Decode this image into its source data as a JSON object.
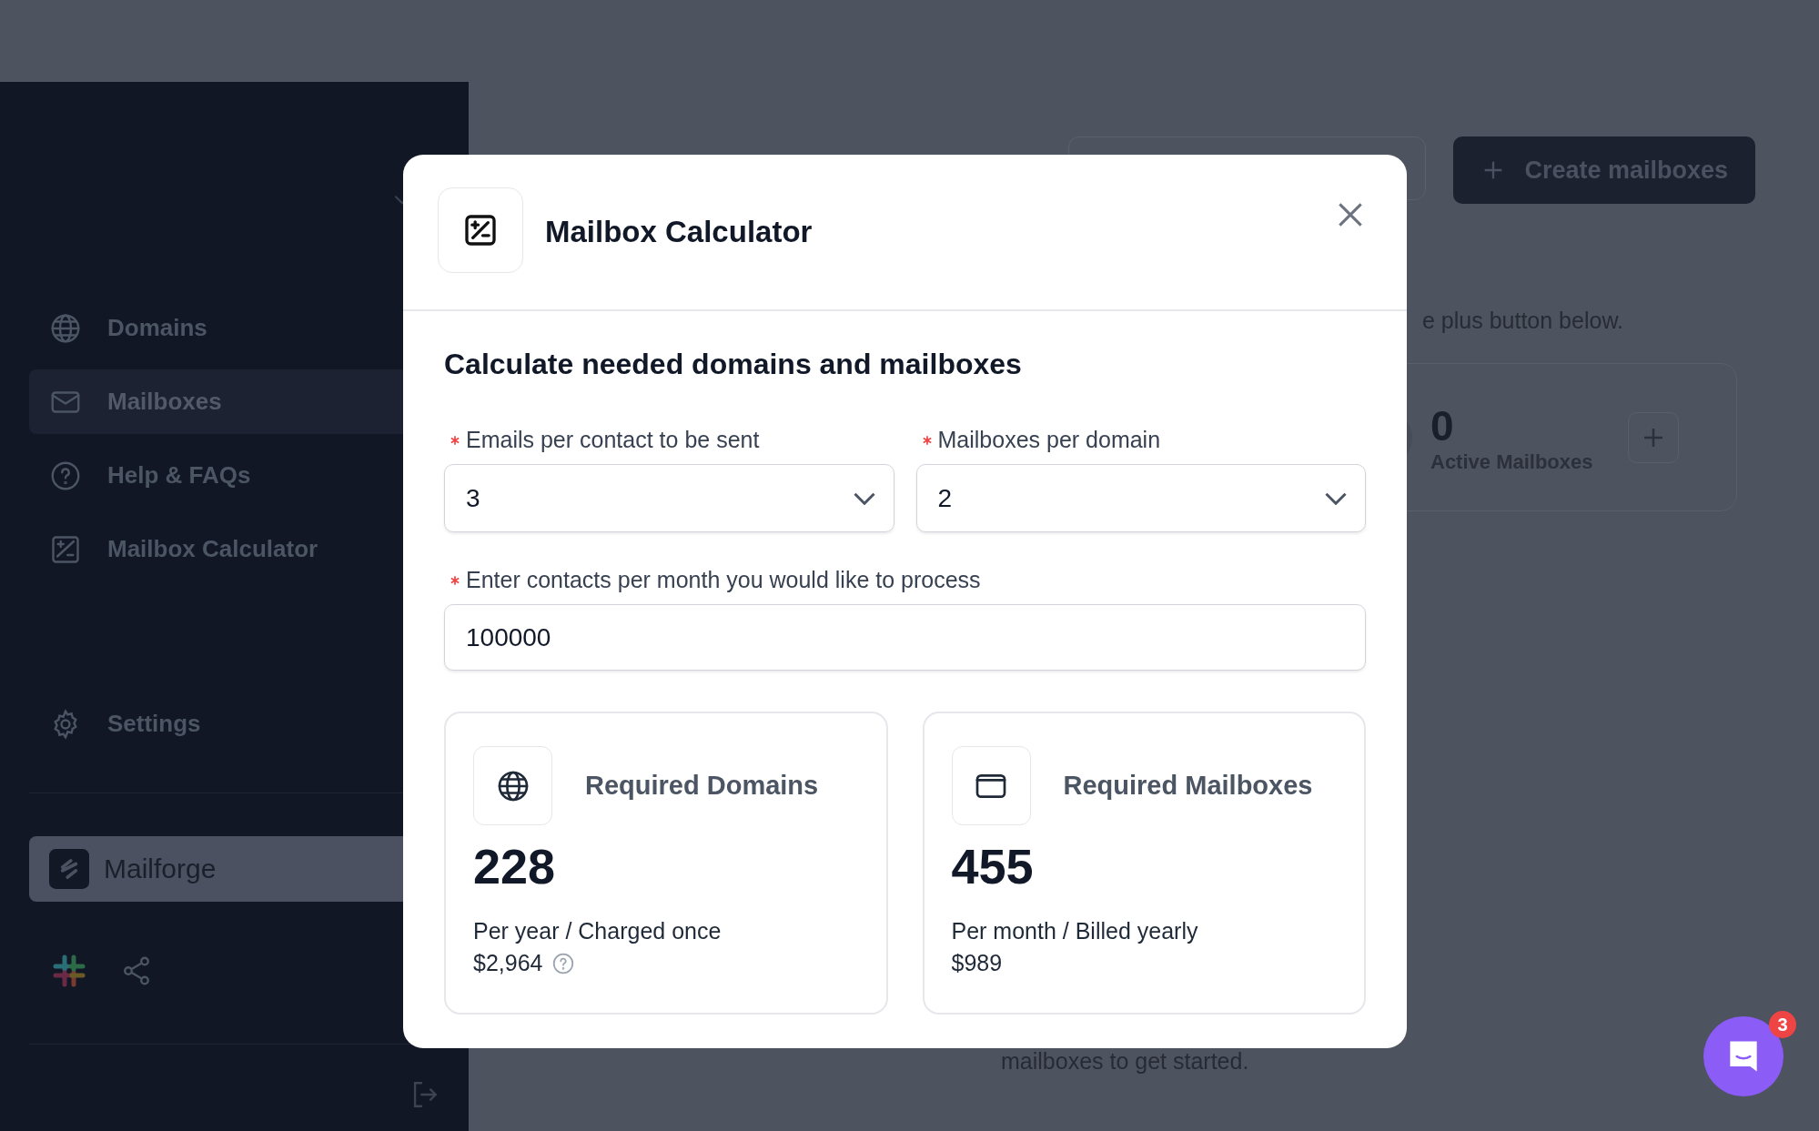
{
  "sidebar": {
    "items": [
      {
        "label": "Domains",
        "kind": "globe",
        "selected": false
      },
      {
        "label": "Mailboxes",
        "kind": "mail",
        "selected": true
      },
      {
        "label": "Help & FAQs",
        "kind": "help",
        "selected": false
      },
      {
        "label": "Mailbox Calculator",
        "kind": "calc",
        "selected": false
      }
    ],
    "settings": {
      "label": "Settings",
      "kind": "gear"
    },
    "workspace": {
      "name": "Mailforge"
    }
  },
  "main": {
    "create_button": "Create mailboxes",
    "hint": "e plus button below.",
    "stats": [
      {
        "value": "0",
        "label": "Active Mailboxes"
      }
    ],
    "empty_text": "mailboxes to get started."
  },
  "modal": {
    "title": "Mailbox Calculator",
    "heading": "Calculate needed domains and mailboxes",
    "selects": [
      {
        "label": "Emails per contact to be sent",
        "value": "3",
        "required": true
      },
      {
        "label": "Mailboxes per domain",
        "value": "2",
        "required": true
      }
    ],
    "input": {
      "label": "Enter contacts per month you would like to process",
      "value": "100000",
      "required": true
    },
    "results": [
      {
        "title": "Required Domains",
        "kind": "globe",
        "value": "228",
        "note": "Per year / Charged once",
        "price": "$2,964",
        "info": true
      },
      {
        "title": "Required Mailboxes",
        "kind": "mail",
        "value": "455",
        "note": "Per month / Billed yearly",
        "price": "$989",
        "info": false
      }
    ]
  },
  "chat": {
    "badge": "3"
  }
}
